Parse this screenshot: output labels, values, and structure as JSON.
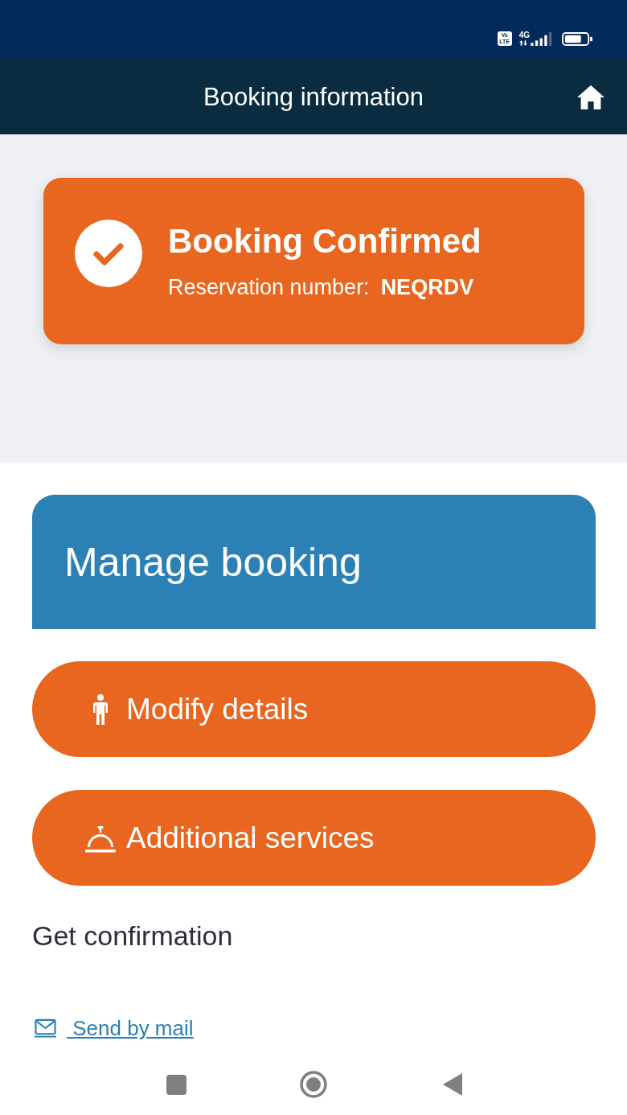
{
  "status_bar": {
    "volte_badge": "Vo LTE",
    "network": "4G"
  },
  "header": {
    "title": "Booking information"
  },
  "confirmation_card": {
    "title": "Booking Confirmed",
    "reservation_label": "Reservation number:",
    "reservation_number": "NEQRDV"
  },
  "manage_panel": {
    "title": "Manage booking"
  },
  "actions": [
    {
      "kind": "person",
      "label": "Modify details"
    },
    {
      "kind": "bell",
      "label": "Additional services"
    }
  ],
  "get_confirmation": {
    "heading": "Get confirmation",
    "links": [
      {
        "kind": "mail",
        "label": " Send by mail"
      }
    ]
  }
}
